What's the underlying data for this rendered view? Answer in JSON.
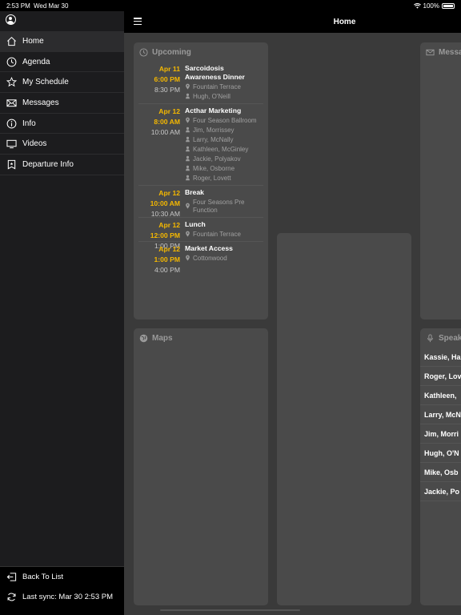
{
  "status": {
    "time": "2:53 PM",
    "date": "Wed Mar 30",
    "battery": "100%"
  },
  "sidebar": {
    "items": [
      {
        "label": "Home",
        "icon": "home-icon"
      },
      {
        "label": "Agenda",
        "icon": "clock-icon"
      },
      {
        "label": "My Schedule",
        "icon": "star-icon"
      },
      {
        "label": "Messages",
        "icon": "envelope-icon"
      },
      {
        "label": "Info",
        "icon": "info-icon"
      },
      {
        "label": "Videos",
        "icon": "monitor-icon"
      },
      {
        "label": "Departure Info",
        "icon": "plane-icon"
      }
    ],
    "back_label": "Back To List",
    "sync_label": "Last sync:  Mar 30 2:53 PM"
  },
  "header": {
    "title": "Home"
  },
  "upcoming": {
    "title": "Upcoming",
    "events": [
      {
        "date": "Apr 11",
        "start": "6:00 PM",
        "end": "8:30 PM",
        "title": "Sarcoidosis Awareness Dinner",
        "location": "Fountain Terrace",
        "people": [
          "Hugh, O'Neill"
        ]
      },
      {
        "date": "Apr 12",
        "start": "8:00 AM",
        "end": "10:00 AM",
        "title": "Acthar Marketing",
        "location": "Four Season Ballroom",
        "people": [
          "Jim, Morrissey",
          "Larry, McNally",
          "Kathleen, McGinley",
          "Jackie, Polyakov",
          "Mike, Osborne",
          "Roger, Lovett"
        ]
      },
      {
        "date": "Apr 12",
        "start": "10:00 AM",
        "end": "10:30 AM",
        "title": "Break",
        "location": "Four Seasons Pre Function",
        "people": []
      },
      {
        "date": "Apr 12",
        "start": "12:00 PM",
        "end": "1:00 PM",
        "title": "Lunch",
        "location": "Fountain Terrace",
        "people": []
      },
      {
        "date": "Apr 12",
        "start": "1:00 PM",
        "end": "4:00 PM",
        "title": "Market Access",
        "location": "Cottonwood",
        "people": []
      }
    ]
  },
  "maps": {
    "title": "Maps"
  },
  "messages": {
    "title": "Messa"
  },
  "speakers": {
    "title": "Speak",
    "names": [
      "Kassie, Ha",
      "Roger, Lov",
      "Kathleen,",
      "Larry, McN",
      "Jim, Morri",
      "Hugh, O'N",
      "Mike, Osb",
      "Jackie, Po"
    ]
  }
}
